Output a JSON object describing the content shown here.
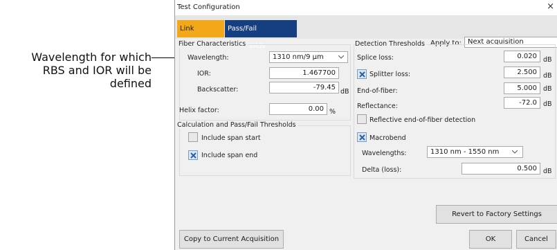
{
  "callout": {
    "line1": "Wavelength for which",
    "line2": "RBS and IOR will be",
    "line3": "defined"
  },
  "window": {
    "title": "Test Configuration",
    "close": "×"
  },
  "tabs": [
    {
      "label": "Link Definition"
    },
    {
      "label": "Pass/Fail Thresholds"
    }
  ],
  "apply_to": {
    "label": "Apply to:",
    "value": "Next acquisition"
  },
  "fiber": {
    "title": "Fiber Characteristics",
    "wavelength_label": "Wavelength:",
    "wavelength_value": "1310 nm/9 μm",
    "ior_label": "IOR:",
    "ior_value": "1.467700",
    "backscatter_label": "Backscatter:",
    "backscatter_value": "-79.45",
    "backscatter_unit": "dB",
    "helix_label": "Helix factor:",
    "helix_value": "0.00",
    "helix_unit": "%"
  },
  "calc": {
    "title": "Calculation and Pass/Fail Thresholds",
    "span_start_label": "Include span start",
    "span_start_checked": false,
    "span_end_label": "Include span end",
    "span_end_checked": true
  },
  "detection": {
    "title": "Detection Thresholds",
    "splice_label": "Splice loss:",
    "splice_value": "0.020",
    "splitter_label": "Splitter loss:",
    "splitter_value": "2.500",
    "splitter_checked": true,
    "eof_label": "End-of-fiber:",
    "eof_value": "5.000",
    "refl_label": "Reflectance:",
    "refl_value": "-72.0",
    "unit": "dB",
    "reflective_eof_label": "Reflective end-of-fiber detection",
    "reflective_eof_checked": false,
    "macrobend_label": "Macrobend",
    "macrobend_checked": true,
    "wavelengths_label": "Wavelengths:",
    "wavelengths_value": "1310 nm - 1550 nm",
    "delta_label": "Delta (loss):",
    "delta_value": "0.500"
  },
  "buttons": {
    "revert": "Revert to Factory Settings",
    "copy": "Copy to Current Acquisition",
    "ok": "OK",
    "cancel": "Cancel"
  },
  "colors": {
    "tab_active": "#f3a81a",
    "tab_selected": "#163f82",
    "check": "#2c5fa3"
  }
}
